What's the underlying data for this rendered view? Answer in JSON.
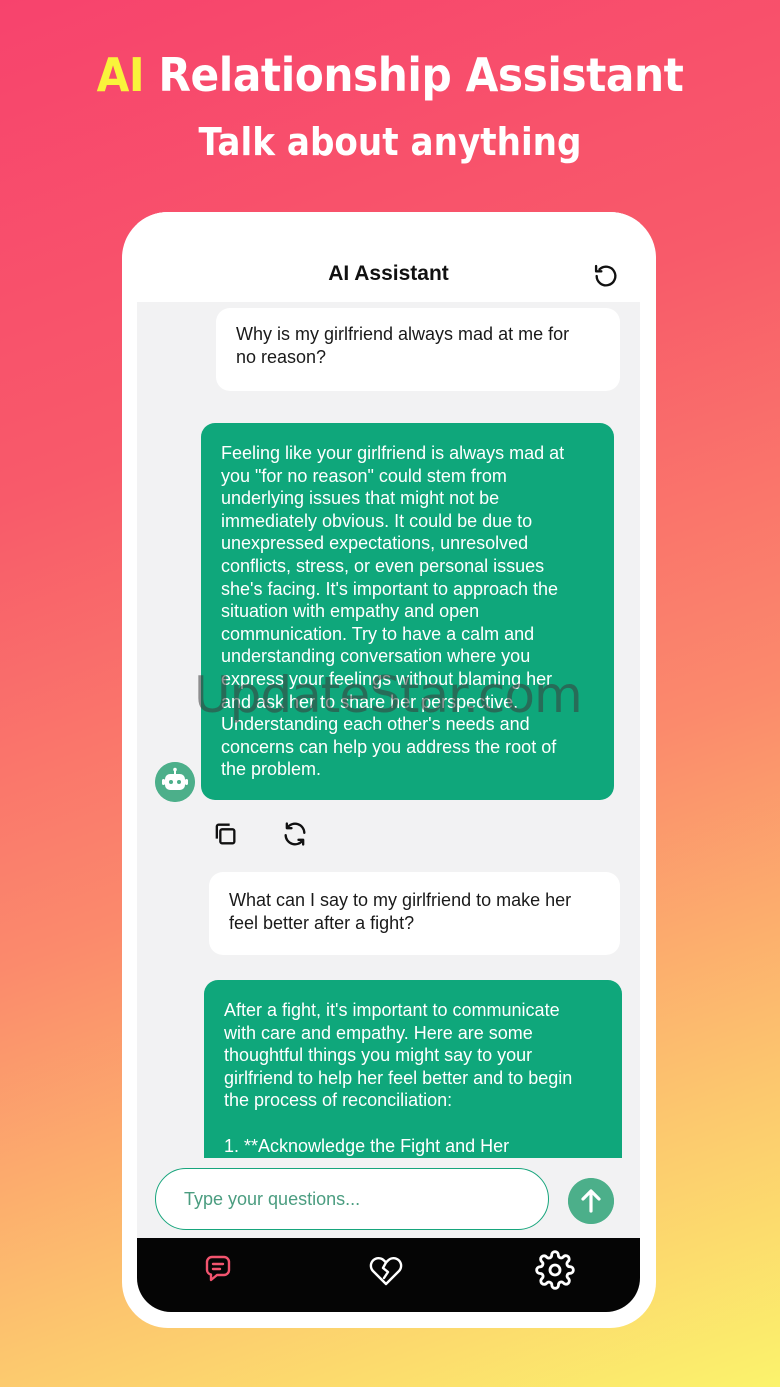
{
  "banner": {
    "headline_accent": "AI",
    "headline_rest": " Relationship Assistant",
    "subline": "Talk about anything"
  },
  "appbar": {
    "title": "AI Assistant"
  },
  "messages": [
    {
      "role": "user",
      "text": "Why is my girlfriend always mad at me for\nno reason?"
    },
    {
      "role": "assistant",
      "text": "Feeling like your girlfriend is always mad at\nyou \"for no reason\" could stem from\nunderlying issues that might not be\nimmediately obvious. It could be due to\nunexpressed expectations, unresolved\nconflicts, stress, or even personal issues\nshe's facing. It's important to approach the\nsituation with empathy and open\ncommunication. Try to have a calm and\nunderstanding conversation where you\nexpress your feelings without blaming her\nand ask her to share her perspective.\nUnderstanding each other's needs and\nconcerns can help you address the root of\nthe problem."
    },
    {
      "role": "user",
      "text": "What can I say to my girlfriend to make her\nfeel better after a fight?"
    },
    {
      "role": "assistant",
      "text": "After a fight, it's important to communicate\nwith care and empathy. Here are some\nthoughtful things you might say to your\ngirlfriend to help her feel better and to begin\nthe process of reconciliation:\n\n1. **Acknowledge the Fight and Her"
    }
  ],
  "input": {
    "placeholder": "Type your questions..."
  },
  "watermark": "UpdateStar.com",
  "icons": {
    "refresh": "history-refresh-icon",
    "avatar": "robot-icon",
    "copy": "copy-icon",
    "regenerate": "regenerate-icon",
    "send": "arrow-up-icon",
    "nav_chat": "chat-bubble-icon",
    "nav_heart": "broken-heart-icon",
    "nav_settings": "gear-icon"
  },
  "colors": {
    "bot_bubble": "#0fa77b",
    "accent_green": "#4caf8a",
    "nav_active": "#f2546e",
    "headline_accent": "#f9f33b"
  }
}
